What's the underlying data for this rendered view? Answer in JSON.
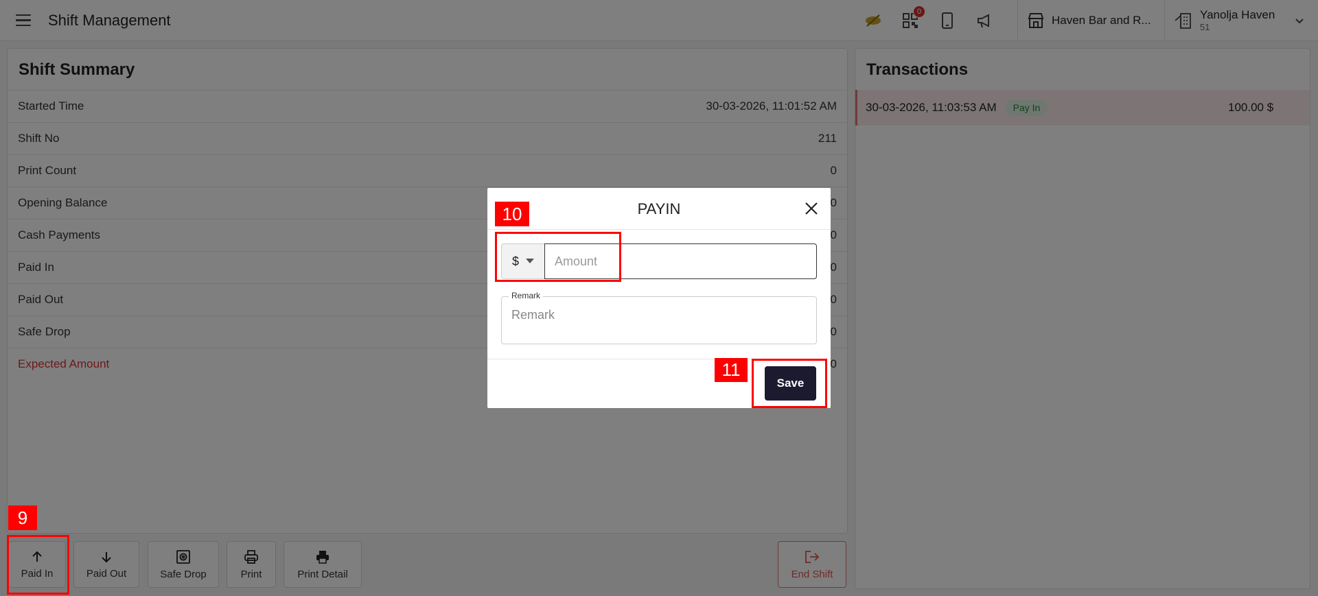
{
  "header": {
    "title": "Shift Management",
    "qr_badge": "0",
    "restaurant": "Haven Bar and R...",
    "user_name": "Yanolja Haven",
    "user_sub": "51"
  },
  "summary": {
    "title": "Shift Summary",
    "rows": [
      {
        "label": "Started Time",
        "value": "30-03-2026, 11:01:52 AM"
      },
      {
        "label": "Shift No",
        "value": "211"
      },
      {
        "label": "Print Count",
        "value": "0"
      },
      {
        "label": "Opening Balance",
        "value": "0"
      },
      {
        "label": "Cash Payments",
        "value": "0"
      },
      {
        "label": "Paid In",
        "value": "0"
      },
      {
        "label": "Paid Out",
        "value": "0"
      },
      {
        "label": "Safe Drop",
        "value": "0"
      },
      {
        "label": "Expected Amount",
        "value": "0"
      }
    ]
  },
  "transactions": {
    "title": "Transactions",
    "items": [
      {
        "time": "30-03-2026, 11:03:53 AM",
        "type": "Pay In",
        "amount": "100.00 $"
      }
    ]
  },
  "actions": {
    "paid_in": "Paid In",
    "paid_out": "Paid Out",
    "safe_drop": "Safe Drop",
    "print": "Print",
    "print_detail": "Print Detail",
    "end_shift": "End Shift"
  },
  "modal": {
    "title": "PAYIN",
    "currency": "$",
    "amount_placeholder": "Amount",
    "remark_label": "Remark",
    "remark_placeholder": "Remark",
    "save_label": "Save"
  },
  "annotations": {
    "step_9": "9",
    "step_10": "10",
    "step_11": "11"
  },
  "colors": {
    "annotation": "#ff0000",
    "save_button": "#1c1a2e",
    "expected_amount": "#dd3333",
    "pay_in_pill": "#dff0e0"
  }
}
